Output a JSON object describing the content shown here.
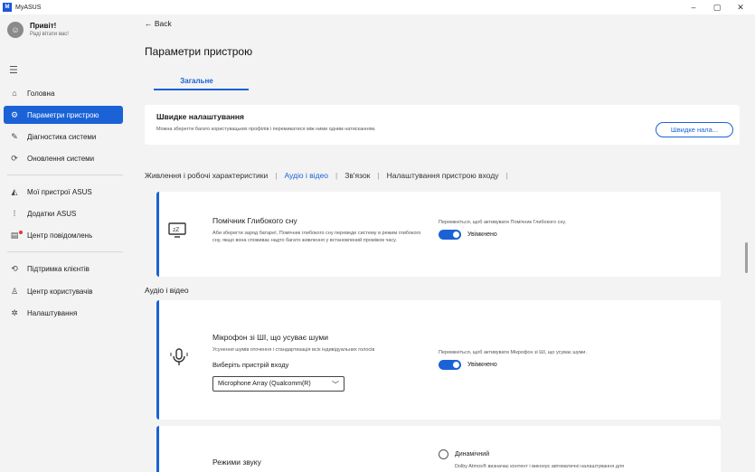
{
  "window": {
    "title": "MyASUS",
    "logo_text": "M",
    "minimize": "–",
    "maximize": "▢",
    "close": "✕"
  },
  "user": {
    "greeting": "Привіт!",
    "subtitle": "Раді вітати вас!"
  },
  "sidebar": {
    "items": [
      {
        "label": "Головна",
        "icon": "home-icon",
        "glyph": "⌂"
      },
      {
        "label": "Параметри пристрою",
        "icon": "device-settings-icon",
        "glyph": "⚙"
      },
      {
        "label": "Діагностика системи",
        "icon": "stethoscope-icon",
        "glyph": "✎"
      },
      {
        "label": "Оновлення системи",
        "icon": "update-icon",
        "glyph": "⟳"
      },
      {
        "label": "Мої пристрої ASUS",
        "icon": "devices-icon",
        "glyph": "◭"
      },
      {
        "label": "Додатки ASUS",
        "icon": "apps-grid-icon",
        "glyph": "⁞"
      },
      {
        "label": "Центр повідомлень",
        "icon": "notification-icon",
        "glyph": "▤"
      },
      {
        "label": "Підтримка клієнтів",
        "icon": "support-icon",
        "glyph": "⟲"
      },
      {
        "label": "Центр користувачів",
        "icon": "user-icon",
        "glyph": "♙"
      },
      {
        "label": "Налаштування",
        "icon": "gear-icon",
        "glyph": "✲"
      }
    ]
  },
  "main": {
    "back_label": "Back",
    "page_title": "Параметри пристрою",
    "tab_general": "Загальне",
    "quick": {
      "title": "Швидке налаштування",
      "description": "Можна зберегти багато користувацьких профілів і перемикатися між ними одним натисканням.",
      "button": "Швидке нала..."
    },
    "subtabs": [
      "Живлення і робочі характеристики",
      "Аудіо і відео",
      "Зв'язок",
      "Налаштування пристрою входу"
    ],
    "sleep": {
      "title": "Помічник Глибокого сну",
      "description": "Аби зберегти заряд батареї, Помічник глибокого сну переведе систему в режим глибокого сну, якщо вона споживає надто багато живлення у встановлений проміжок часу.",
      "hint": "Перемкніться, щоб активувати Помічник Глибокого сну.",
      "state": "Увімкнено"
    },
    "section_audio_video": "Аудіо і відео",
    "mic": {
      "title": "Мікрофон зі ШІ, що усуває шуми",
      "description": "Усунення шумів оточення і стандартизація всіх індивідуальних голосів",
      "select_label": "Виберіть пристрій входу",
      "select_value": "Microphone Array (Qualcomm(R)",
      "hint": "Перемкніться, щоб активувати Мікрофон зі ШІ, що усуває шуми.",
      "state": "Увімкнено"
    },
    "sound": {
      "title": "Режими звуку",
      "option": "Динамічний",
      "option_desc": "Dolby Atmos® визначає контент і виконує автоматичні налаштування для"
    }
  },
  "colors": {
    "accent": "#1a62d6",
    "notification_dot": "#e33333"
  }
}
